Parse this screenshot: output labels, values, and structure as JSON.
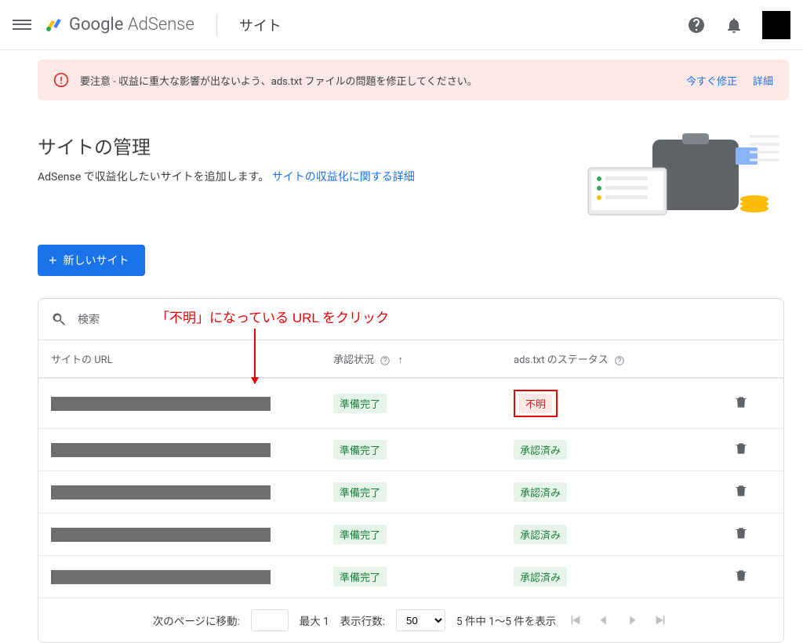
{
  "header": {
    "brand_google": "Google",
    "brand_product": " AdSense",
    "page_label": "サイト"
  },
  "alert": {
    "text": "要注意 - 収益に重大な影響が出ないよう、ads.txt ファイルの問題を修正してください。",
    "fix_now": "今すぐ修正",
    "details": "詳細"
  },
  "main": {
    "title": "サイトの管理",
    "subtitle_prefix": "AdSense で収益化したいサイトを追加します。 ",
    "subtitle_link": "サイトの収益化に関する詳細",
    "new_site_label": "新しいサイト"
  },
  "annotation": "「不明」になっている URL をクリック",
  "search": {
    "placeholder": "検索"
  },
  "table": {
    "col_url": "サイトの URL",
    "col_status": "承認状況",
    "col_ads": "ads.txt のステータス",
    "sort_indicator": "↑",
    "rows": [
      {
        "status": "準備完了",
        "ads": "不明",
        "ads_kind": "unknown"
      },
      {
        "status": "準備完了",
        "ads": "承認済み",
        "ads_kind": "approved"
      },
      {
        "status": "準備完了",
        "ads": "承認済み",
        "ads_kind": "approved"
      },
      {
        "status": "準備完了",
        "ads": "承認済み",
        "ads_kind": "approved"
      },
      {
        "status": "準備完了",
        "ads": "承認済み",
        "ads_kind": "approved"
      }
    ]
  },
  "pager": {
    "goto_label": "次のページに移動:",
    "max_label": "最大 1",
    "rows_label": "表示行数:",
    "rows_value": "50",
    "range_label": "5 件中 1～5 件を表示"
  }
}
